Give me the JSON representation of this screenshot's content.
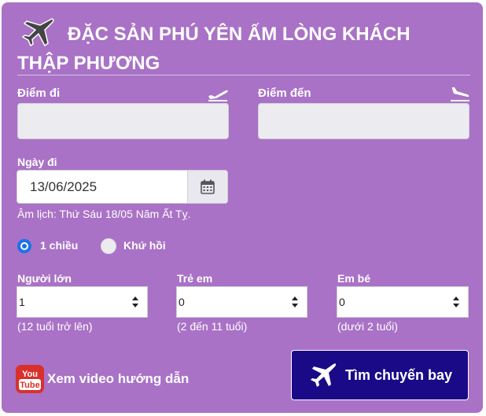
{
  "header": {
    "title_line1": "ĐẶC SẢN PHÚ YÊN ẤM LÒNG KHÁCH",
    "title_line2": "THẬP PHƯƠNG"
  },
  "from": {
    "label": "Điểm đi",
    "value": ""
  },
  "to": {
    "label": "Điểm đến",
    "value": ""
  },
  "date": {
    "label": "Ngày đi",
    "value": "13/06/2025",
    "lunar": "Âm lịch: Thứ Sáu 18/05 Năm Ất Tỵ."
  },
  "trip_type": {
    "one_way": "1 chiều",
    "round_trip": "Khứ hồi",
    "selected": "one_way"
  },
  "passengers": {
    "adults": {
      "label": "Người lớn",
      "value": "1",
      "hint": "(12 tuổi trở lên)"
    },
    "children": {
      "label": "Trẻ em",
      "value": "0",
      "hint": "(2 đến 11 tuổi)"
    },
    "infants": {
      "label": "Em bé",
      "value": "0",
      "hint": "(dưới 2 tuổi)"
    }
  },
  "video_link": {
    "label": "Xem video hướng dẫn",
    "icon_text_top": "You",
    "icon_text_bottom": "Tube"
  },
  "search_button": {
    "label": "Tìm chuyến bay"
  },
  "colors": {
    "panel": "#a972c6",
    "button": "#1a0a88",
    "radio_active": "#1a73e8",
    "youtube": "#d9302b"
  },
  "icons": [
    "airplane-icon",
    "takeoff-icon",
    "landing-icon",
    "calendar-icon",
    "sort-arrows-icon",
    "youtube-icon",
    "airplane-button-icon"
  ]
}
